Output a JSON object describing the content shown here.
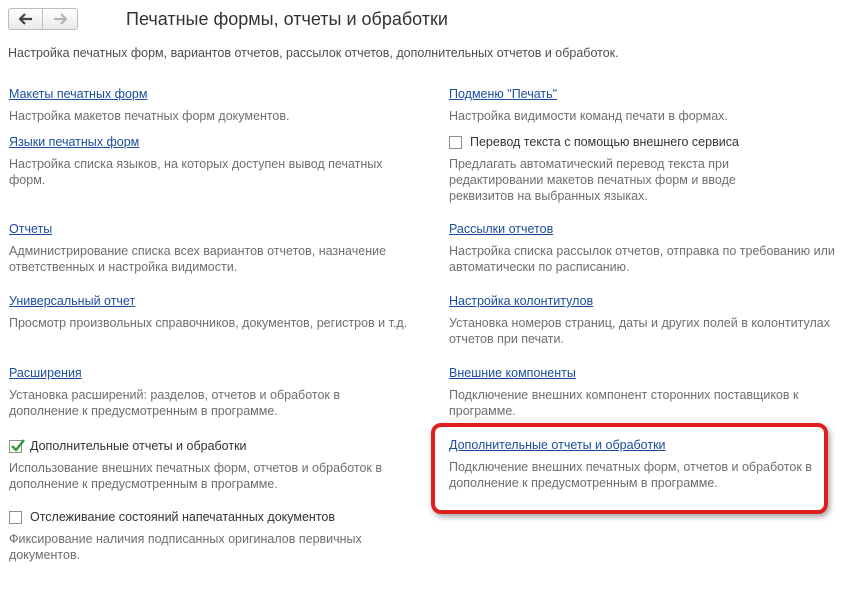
{
  "header": {
    "title": "Печатные формы, отчеты и обработки",
    "subtitle": "Настройка печатных форм, вариантов отчетов, рассылок отчетов, дополнительных отчетов и обработок.",
    "back_icon": "arrow-left-icon",
    "forward_icon": "arrow-right-icon"
  },
  "left": {
    "print_layouts": {
      "label": "Макеты печатных форм",
      "desc": "Настройка макетов печатных форм документов."
    },
    "print_languages": {
      "label": "Языки печатных форм",
      "desc": "Настройка списка языков, на которых доступен вывод печатных форм."
    },
    "reports": {
      "label": "Отчеты",
      "desc": "Администрирование списка всех вариантов отчетов, назначение ответственных и настройка видимости."
    },
    "universal_report": {
      "label": "Универсальный отчет",
      "desc": "Просмотр произвольных справочников, документов, регистров и т.д."
    },
    "extensions": {
      "label": "Расширения",
      "desc": "Установка расширений: разделов, отчетов и обработок в дополнение к предусмотренным в программе."
    },
    "additional_reports": {
      "label": "Дополнительные отчеты и обработки",
      "checked": true,
      "desc": "Использование внешних печатных форм, отчетов и обработок в дополнение к предусмотренным в программе."
    },
    "tracking": {
      "label": "Отслеживание состояний напечатанных документов",
      "checked": false,
      "desc": "Фиксирование наличия подписанных оригиналов первичных документов."
    }
  },
  "right": {
    "print_submenu": {
      "label": "Подменю \"Печать\"",
      "desc": "Настройка видимости команд печати в формах."
    },
    "translation": {
      "label": "Перевод текста с помощью внешнего сервиса",
      "checked": false,
      "desc": "Предлагать автоматический перевод текста при редактировании макетов печатных форм и вводе реквизитов на выбранных языках."
    },
    "report_mailings": {
      "label": "Рассылки отчетов",
      "desc": "Настройка списка рассылок отчетов, отправка по требованию или автоматически по расписанию."
    },
    "headers_footers": {
      "label": "Настройка колонтитулов",
      "desc": "Установка номеров страниц, даты и других полей в колонтитулах отчетов при печати."
    },
    "external_components": {
      "label": "Внешние компоненты",
      "desc": "Подключение внешних компонент сторонних поставщиков к программе."
    },
    "additional_reports_link": {
      "label": "Дополнительные отчеты и обработки",
      "desc": "Подключение внешних печатных форм, отчетов и обработок в дополнение к предусмотренным в программе."
    }
  },
  "colors": {
    "link": "#1a4e9c",
    "description": "#6f6f6f",
    "highlight": "#e01e1e",
    "check": "#2e9a3a"
  }
}
